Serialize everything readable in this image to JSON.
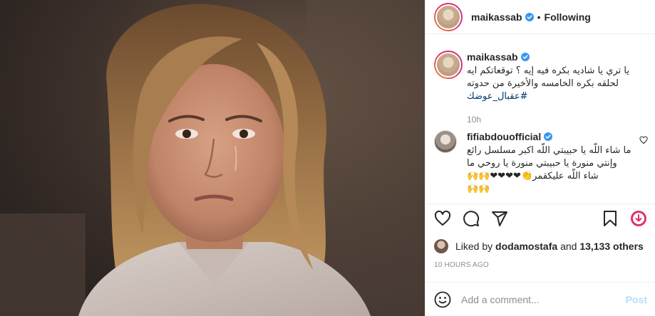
{
  "header": {
    "username": "maikassab",
    "separator": "•",
    "follow_status": "Following"
  },
  "caption": {
    "username": "maikassab",
    "text_line1": "يا تري يا شاديه بكره فيه إيه ؟ توقعاتكم ايه لحلقه بكره الخامسه والأخيرة من حدوته",
    "hashtag": "#عقبال_عوضك",
    "time": "10h"
  },
  "comment1": {
    "username": "fifiabdouofficial",
    "text": "ما شاء اللّه يا حبيبتي اللّه اكبر مسلسل رائع وإنتي منورة يا حبيبتي منورة يا روحي ما شاء اللّه عليكقمر👏❤❤❤❤🙌🙌",
    "text_tail": "🙌🙌"
  },
  "likes": {
    "prefix": "Liked by",
    "user": "dodamostafa",
    "middle": "and",
    "count": "13,133 others"
  },
  "timestamp": "10 HOURS AGO",
  "add_comment": {
    "placeholder": "Add a comment...",
    "post_label": "Post"
  },
  "icons": {
    "like": "heart-icon",
    "comment": "comment-bubble-icon",
    "share": "paper-plane-icon",
    "save": "bookmark-icon",
    "download": "download-circle-icon",
    "emoji": "smiley-icon",
    "verified": "verified-badge-icon"
  },
  "colors": {
    "verified": "#3897f0",
    "hashtag": "#00376b",
    "muted": "#8e8e8e",
    "post_disabled": "#b2dffc",
    "download_badge": "#e1306c"
  }
}
